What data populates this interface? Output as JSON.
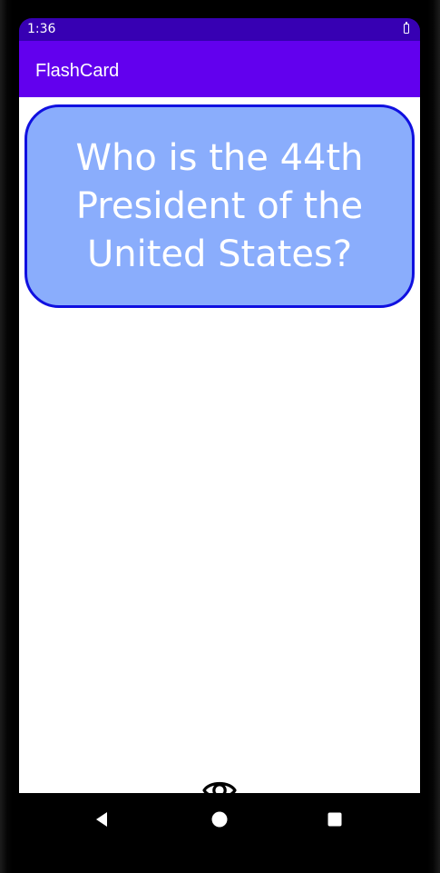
{
  "status_bar": {
    "time": "1:36",
    "battery_icon": "battery-icon",
    "color": "#3700b3"
  },
  "app_bar": {
    "title": "FlashCard",
    "color": "#6200ee"
  },
  "card": {
    "question": "Who is the 44th President of the United States?",
    "background_color": "#8aadfc",
    "border_color": "#1010e0"
  },
  "reveal_button": {
    "icon": "eye-icon"
  },
  "nav_bar": {
    "back_icon": "back-triangle-icon",
    "home_icon": "home-circle-icon",
    "recents_icon": "recents-square-icon"
  }
}
